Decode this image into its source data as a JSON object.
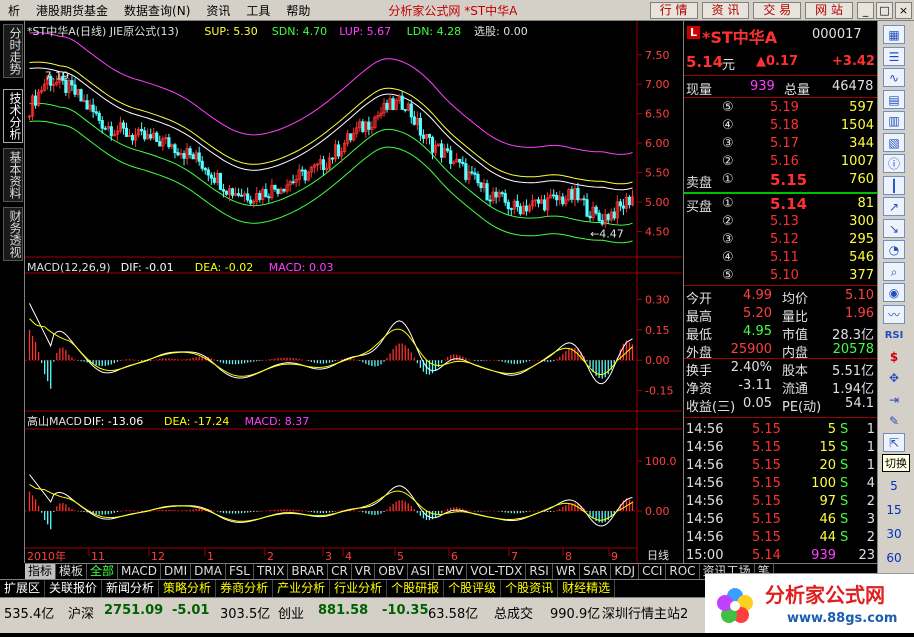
{
  "menubar": {
    "items": [
      "析",
      "港股期货基金",
      "数据查询(N)",
      "资讯",
      "工具",
      "帮助"
    ],
    "title": "分析家公式网 *ST中华A",
    "buttons": [
      "行 情",
      "资 讯",
      "交 易",
      "网 站"
    ]
  },
  "left_tabs": [
    "分时走势",
    "技术分析",
    "基本资料",
    "财务透视"
  ],
  "panels": {
    "main": {
      "label": "*ST中华A(日线) JIE原公式(13)",
      "sup": "SUP: 5.30",
      "sdn": "SDN: 4.70",
      "lup": "LUP: 5.67",
      "ldn": "LDN: 4.28",
      "xg": "选股: 0.00",
      "ann_high": "7.19",
      "ann_low": "4.47",
      "yticks": [
        "7.50",
        "7.00",
        "6.50",
        "6.00",
        "5.50",
        "5.00",
        "4.50"
      ]
    },
    "macd": {
      "label": "MACD(12,26,9)",
      "dif": "DIF: -0.01",
      "dea": "DEA: -0.02",
      "macd": "MACD: 0.03",
      "yticks": [
        "0.30",
        "0.15",
        "0.00",
        "-0.15"
      ]
    },
    "gsmacd": {
      "label": "高山MACD",
      "dif": "DIF: -13.06",
      "dea": "DEA: -17.24",
      "macd": "MACD: 8.37",
      "yticks": [
        "100.0",
        "0.00"
      ]
    }
  },
  "xaxis": {
    "year": "2010年",
    "months": [
      "11",
      "12",
      "1",
      "2",
      "3",
      "4",
      "5",
      "6",
      "7",
      "8",
      "9"
    ],
    "period": "日线"
  },
  "quote": {
    "name": "*ST中华A",
    "code": "000017",
    "price": "5.14",
    "unit": "元",
    "change": "▲0.17",
    "change_pct": "+3.42",
    "xl_label": "现量",
    "xl": "939",
    "zl_label": "总量",
    "zl": "46478",
    "asks": [
      {
        "n": "⑤",
        "p": "5.19",
        "v": "597"
      },
      {
        "n": "④",
        "p": "5.18",
        "v": "1504"
      },
      {
        "n": "③",
        "p": "5.17",
        "v": "344"
      },
      {
        "n": "②",
        "p": "5.16",
        "v": "1007"
      },
      {
        "n": "①",
        "p": "5.15",
        "v": "760",
        "label": "卖盘"
      }
    ],
    "bids": [
      {
        "n": "①",
        "p": "5.14",
        "v": "81",
        "label": "买盘"
      },
      {
        "n": "②",
        "p": "5.13",
        "v": "300"
      },
      {
        "n": "③",
        "p": "5.12",
        "v": "295"
      },
      {
        "n": "④",
        "p": "5.11",
        "v": "546"
      },
      {
        "n": "⑤",
        "p": "5.10",
        "v": "377"
      }
    ],
    "stats": [
      {
        "l1": "今开",
        "v1": "4.99",
        "c1": "#ff4040",
        "l2": "均价",
        "v2": "5.10",
        "c2": "#ff4040"
      },
      {
        "l1": "最高",
        "v1": "5.20",
        "c1": "#ff4040",
        "l2": "量比",
        "v2": "1.96",
        "c2": "#ff4040"
      },
      {
        "l1": "最低",
        "v1": "4.95",
        "c1": "#40ff40",
        "l2": "市值",
        "v2": "28.3亿",
        "c2": "#e0e0e0"
      },
      {
        "l1": "外盘",
        "v1": "25900",
        "c1": "#ff4040",
        "l2": "内盘",
        "v2": "20578",
        "c2": "#40ff40"
      },
      {
        "l1": "换手",
        "v1": "2.40%",
        "c1": "#e0e0e0",
        "l2": "股本",
        "v2": "5.51亿",
        "c2": "#e0e0e0"
      },
      {
        "l1": "净资",
        "v1": "-3.11",
        "c1": "#e0e0e0",
        "l2": "流通",
        "v2": "1.94亿",
        "c2": "#e0e0e0"
      },
      {
        "l1": "收益(三)",
        "v1": "0.05",
        "c1": "#e0e0e0",
        "l2": "PE(动)",
        "v2": "54.1",
        "c2": "#e0e0e0"
      }
    ],
    "ticks": [
      {
        "t": "14:56",
        "p": "5.15",
        "v": "5",
        "bs": "S",
        "n": "1"
      },
      {
        "t": "14:56",
        "p": "5.15",
        "v": "15",
        "bs": "S",
        "n": "1"
      },
      {
        "t": "14:56",
        "p": "5.15",
        "v": "20",
        "bs": "S",
        "n": "1"
      },
      {
        "t": "14:56",
        "p": "5.15",
        "v": "100",
        "bs": "S",
        "n": "4"
      },
      {
        "t": "14:56",
        "p": "5.15",
        "v": "97",
        "bs": "S",
        "n": "2"
      },
      {
        "t": "14:56",
        "p": "5.15",
        "v": "46",
        "bs": "S",
        "n": "3"
      },
      {
        "t": "14:56",
        "p": "5.15",
        "v": "44",
        "bs": "S",
        "n": "2"
      },
      {
        "t": "15:00",
        "p": "5.14",
        "v": "939",
        "bs": "",
        "n": "23"
      }
    ]
  },
  "toolbar": {
    "nums": [
      "5",
      "15",
      "30",
      "60"
    ],
    "tooltip": "切换"
  },
  "indicator_tabs": [
    "指标",
    "模板",
    "全部",
    "MACD",
    "DMI",
    "DMA",
    "FSL",
    "TRIX",
    "BRAR",
    "CR",
    "VR",
    "OBV",
    "ASI",
    "EMV",
    "VOL-TDX",
    "RSI",
    "WR",
    "SAR",
    "KDJ",
    "CCI",
    "ROC",
    "资讯工场",
    "笔"
  ],
  "categories": [
    {
      "label": "扩展区",
      "color": "#ffffff"
    },
    {
      "label": "关联报价",
      "color": "#ffffff"
    },
    {
      "label": "新闻分析",
      "color": "#ffffff"
    },
    {
      "label": "策略分析",
      "color": "#ffff00"
    },
    {
      "label": "券商分析",
      "color": "#ffff00"
    },
    {
      "label": "产业分析",
      "color": "#ffff00"
    },
    {
      "label": "行业分析",
      "color": "#ffff00"
    },
    {
      "label": "个股研报",
      "color": "#ffff00"
    },
    {
      "label": "个股评级",
      "color": "#ffff00"
    },
    {
      "label": "个股资讯",
      "color": "#ffff00"
    },
    {
      "label": "财经精选",
      "color": "#ffff00"
    }
  ],
  "status": {
    "a": "535.4亿",
    "b_label": "沪深",
    "b_val": "2751.09",
    "b_chg": "-5.01",
    "b_amt": "303.5亿",
    "c_label": "创业",
    "c_val": "881.58",
    "c_chg": "-10.35",
    "c_amt": "63.58亿",
    "d_label": "总成交",
    "d_val": "990.9亿",
    "e": "深圳行情主站2"
  },
  "logo": {
    "text": "分析家公式网",
    "url": "www.88gs.com"
  },
  "colors": {
    "up": "#ff3030",
    "down": "#54ffff",
    "dif": "#ffffff",
    "dea": "#ffff00",
    "macd": "#ff40ff",
    "sup": "#ffff40",
    "sdn": "#40ff40",
    "lup": "#ff40ff",
    "ldn": "#40ff40"
  }
}
